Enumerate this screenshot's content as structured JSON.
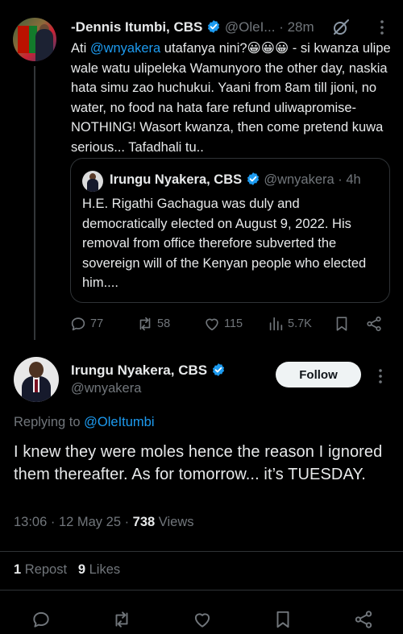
{
  "parent_tweet": {
    "author_name": "-Dennis Itumbi, CBS",
    "handle": "@OleI...",
    "time": "· 28m",
    "text_mention": "@wnyakera",
    "text_before": "Ati ",
    "text_after": " utafanya nini?😀😀😀 - si kwanza ulipe wale watu ulipeleka Wamunyoro the other day, naskia hata simu zao huchukui. Yaani from 8am till jioni, no water, no food na hata fare refund uliwapromise-NOTHING! Wasort kwanza, then come pretend kuwa serious... Tafadhali tu..",
    "quote": {
      "author_name": "Irungu Nyakera, CBS",
      "handle": "@wnyakera",
      "time": "· 4h",
      "text": "H.E. Rigathi Gachagua was duly and democratically elected on August 9, 2022. His removal from office therefore subverted the sovereign will of the Kenyan people who elected him...."
    },
    "actions": {
      "replies": "77",
      "reposts": "58",
      "likes": "115",
      "views": "5.7K"
    }
  },
  "main_tweet": {
    "author_name": "Irungu Nyakera, CBS",
    "handle": "@wnyakera",
    "follow_label": "Follow",
    "replying_prefix": "Replying to ",
    "replying_handle": "@OleItumbi",
    "text": "I knew they were moles hence the reason I ignored them thereafter. As for tomorrow... it’s TUESDAY.",
    "timestamp": "13:06 · 12 May 25 · ",
    "views_count": "738",
    "views_label": " Views",
    "repost_count": "1",
    "repost_label": " Repost",
    "likes_count": "9",
    "likes_label": " Likes"
  },
  "colors": {
    "background": "#000000",
    "text": "#e7e9ea",
    "secondary": "#71767b",
    "accent": "#1d9bf0",
    "divider": "#2f3336"
  }
}
